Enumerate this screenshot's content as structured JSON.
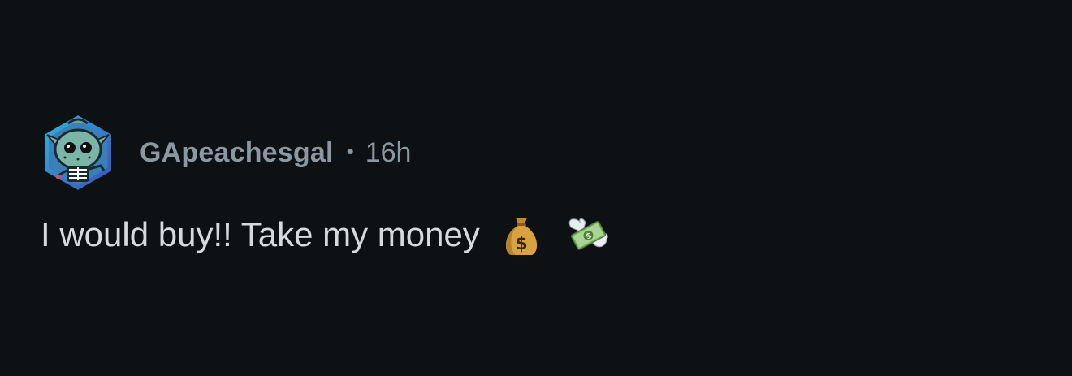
{
  "comment": {
    "author": "GApeachesgal",
    "separator": "•",
    "time": "16h",
    "text": "I would buy!! Take my money",
    "emojis": [
      "money-bag-icon",
      "money-with-wings-icon"
    ]
  },
  "colors": {
    "background": "#0e1114",
    "meta_text": "#8c98a1",
    "body_text": "#d7dadc"
  }
}
